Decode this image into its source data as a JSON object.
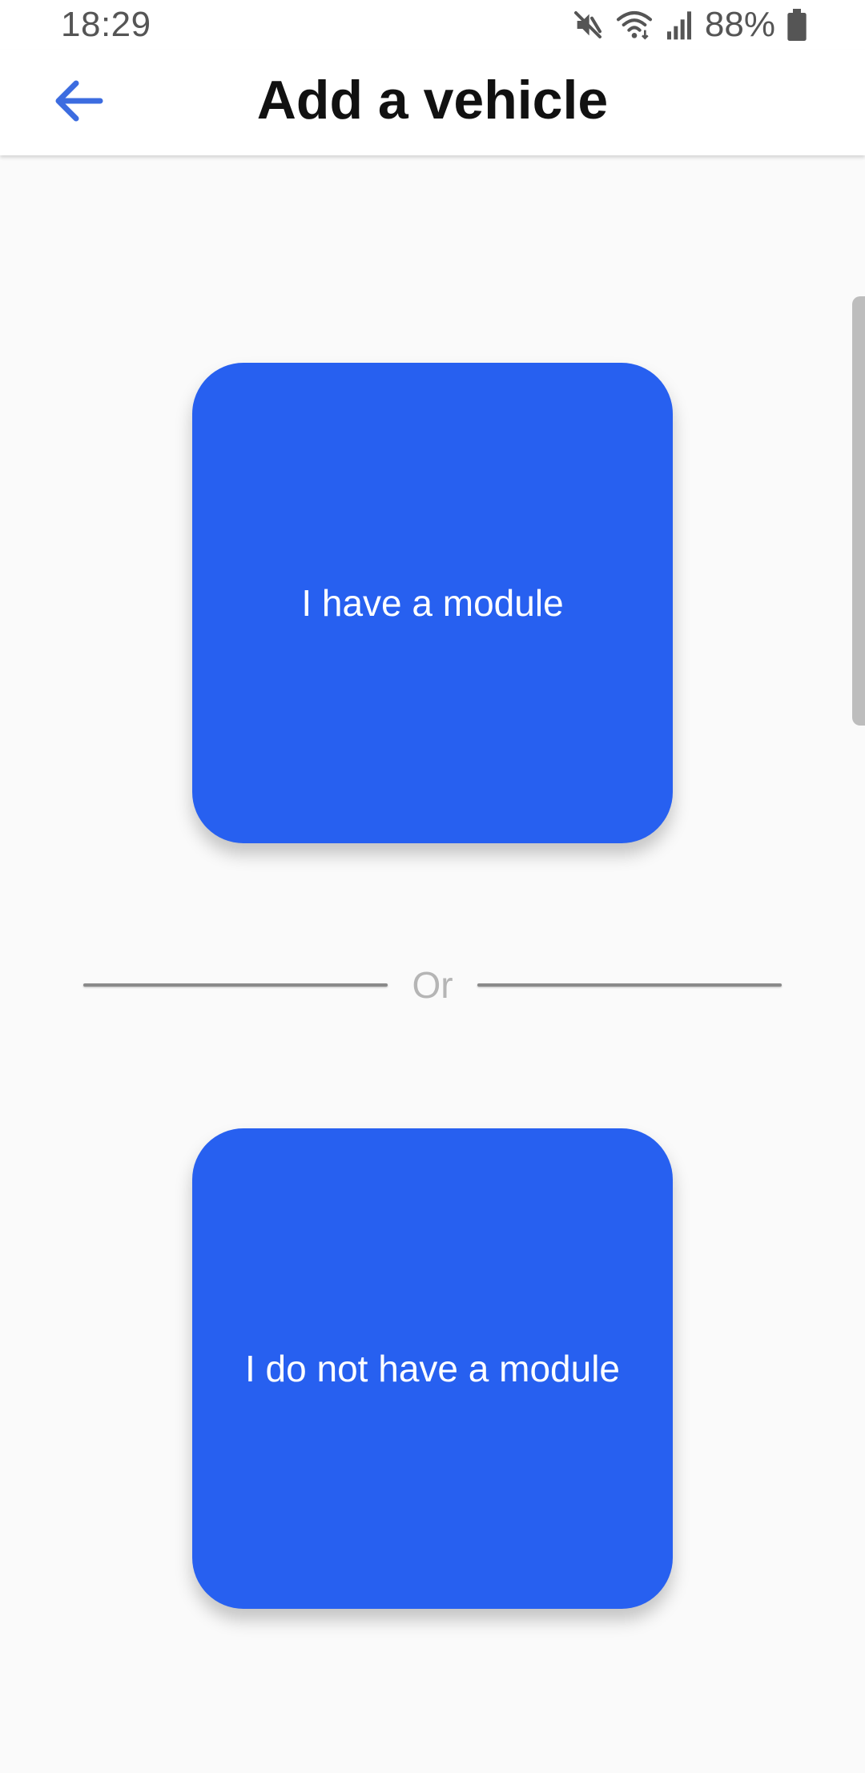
{
  "status_bar": {
    "time": "18:29",
    "battery_percent": "88%",
    "icons": [
      "mute-icon",
      "wifi-icon",
      "signal-icon",
      "battery-icon"
    ]
  },
  "header": {
    "title": "Add a vehicle",
    "back_icon": "arrow-left-icon"
  },
  "options": {
    "have_module_label": "I have a module",
    "no_module_label": "I do not have a module"
  },
  "divider": {
    "text": "Or"
  },
  "colors": {
    "accent": "#2760f0",
    "back_arrow": "#3c6ce0",
    "title": "#111111",
    "divider_text": "#b5b5b5"
  }
}
